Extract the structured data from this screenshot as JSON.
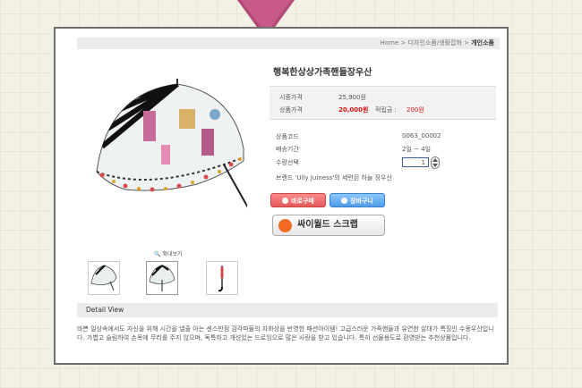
{
  "breadcrumb": {
    "home": "Home",
    "sep": ">",
    "category": "디자인소품/생활잡화",
    "current": "개인소품"
  },
  "product": {
    "title": "행복한상상가족핸들장우산"
  },
  "price": {
    "list_label": "시중가격",
    "list_value": "25,900원",
    "sale_label": "상품가격",
    "sale_value": "20,000원",
    "points_label": "적립금 :",
    "points_value": "200원"
  },
  "info": {
    "code_label": "상품코드",
    "code_value": "0063_00002",
    "ship_label": "배송기간",
    "ship_value": "2일 ~ 4일",
    "qty_label": "수량선택",
    "qty_value": "1",
    "brand_text": "브랜드 'Ully Juiness'의 세련된 하늘 장우산"
  },
  "buttons": {
    "buy": "바로구매",
    "cart": "장바구니",
    "scrap": "싸이월드 스크랩"
  },
  "gallery": {
    "zoom_label": "확대보기"
  },
  "detail": {
    "heading": "Detail View",
    "text": "바쁜 일상속에서도 자신을 위해 시간을 낼줄 아는 센스만점 감각파들의 자화상을 반영한 패션아이템! 고급스러운 가죽핸들과 유연한 살대가 특징인 수동우산입니다. 가볍고 슬림하여 손목에 무리를 주지 않으며, 독특하고 개성있는 드로잉으로 많은 사랑을 받고 있습니다. 특히 선물용도로 환영받는 추천상품입니다."
  },
  "colors": {
    "accent_pink": "#b24a78",
    "price_red": "#d11111",
    "buy_button": "#e35a5a",
    "cart_button": "#4f9be8",
    "border": "#6e6e6e"
  }
}
